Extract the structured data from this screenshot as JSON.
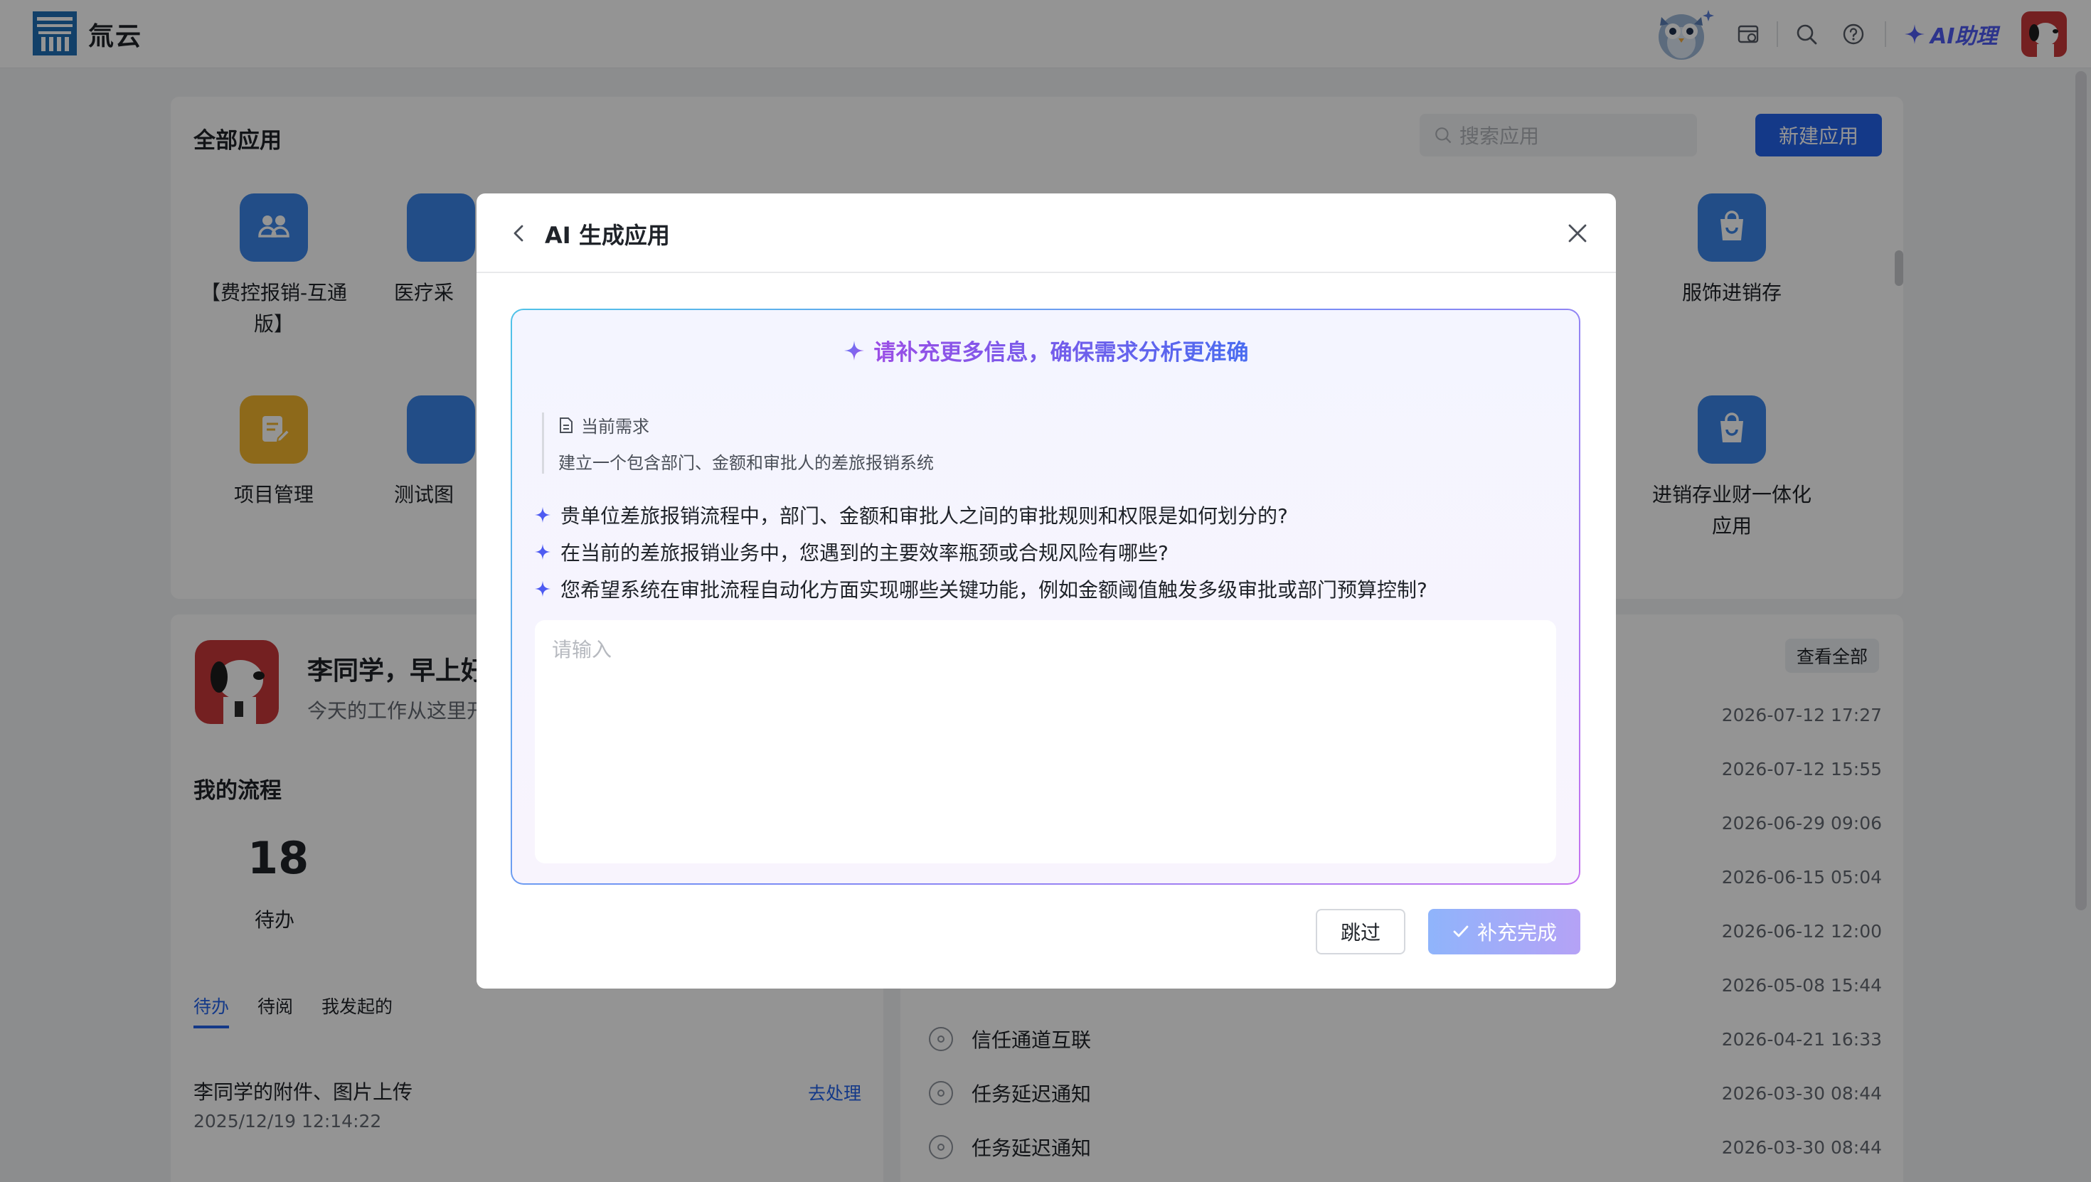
{
  "topbar": {
    "brand": "氚云",
    "ai_assistant_label": "AI助理",
    "icons": [
      "calendar-icon",
      "search-icon",
      "help-icon"
    ]
  },
  "apps_panel": {
    "title": "全部应用",
    "search_placeholder": "搜索应用",
    "new_app_label": "新建应用",
    "apps": [
      {
        "label": "【费控报销-互通版】",
        "color": "#3b86e8",
        "icon": "users-icon"
      },
      {
        "label": "医疗采",
        "color": "#3b86e8",
        "icon": "app-icon"
      },
      {
        "label": "服饰进销存",
        "color": "#3b86e8",
        "icon": "shopping-bag-icon"
      },
      {
        "label": "项目管理",
        "color": "#f3b62e",
        "icon": "document-edit-icon"
      },
      {
        "label": "测试图",
        "color": "#3b86e8",
        "icon": "app-icon"
      },
      {
        "label": "进销存业财一体化应用",
        "color": "#3b86e8",
        "icon": "shopping-bag-icon"
      }
    ]
  },
  "welcome": {
    "greeting": "李同学，早上好",
    "subtitle": "今天的工作从这里开始",
    "my_flows_title": "我的流程",
    "todo_count": "18",
    "todo_label": "待办",
    "tabs": [
      "待办",
      "待阅",
      "我发起的"
    ],
    "task": {
      "name": "李同学的附件、图片上传",
      "date": "2025/12/19 12:14:22",
      "action": "去处理"
    }
  },
  "recent": {
    "view_all": "查看全部",
    "dates": [
      "2026-07-12 17:27",
      "2026-07-12 15:55",
      "2026-06-29 09:06",
      "2026-06-15 05:04",
      "2026-06-12 12:00",
      "2026-05-08 15:44"
    ],
    "rows": [
      {
        "name": "信任通道互联",
        "date": "2026-04-21 16:33"
      },
      {
        "name": "任务延迟通知",
        "date": "2026-03-30 08:44"
      },
      {
        "name": "任务延迟通知",
        "date": "2026-03-30 08:44"
      }
    ]
  },
  "modal": {
    "title": "AI 生成应用",
    "prompt_heading": "请补充更多信息，确保需求分析更准确",
    "current_req_label": "当前需求",
    "current_req_text": "建立一个包含部门、金额和审批人的差旅报销系统",
    "questions": [
      "贵单位差旅报销流程中，部门、金额和审批人之间的审批规则和权限是如何划分的?",
      "在当前的差旅报销业务中，您遇到的主要效率瓶颈或合规风险有哪些?",
      "您希望系统在审批流程自动化方面实现哪些关键功能，例如金额阈值触发多级审批或部门预算控制?"
    ],
    "input_placeholder": "请输入",
    "skip_label": "跳过",
    "done_label": "补充完成"
  },
  "colors": {
    "accent": "#2463eb",
    "ai_purple": "#6c4fe6",
    "mask": "rgba(0,0,0,0.42)"
  }
}
